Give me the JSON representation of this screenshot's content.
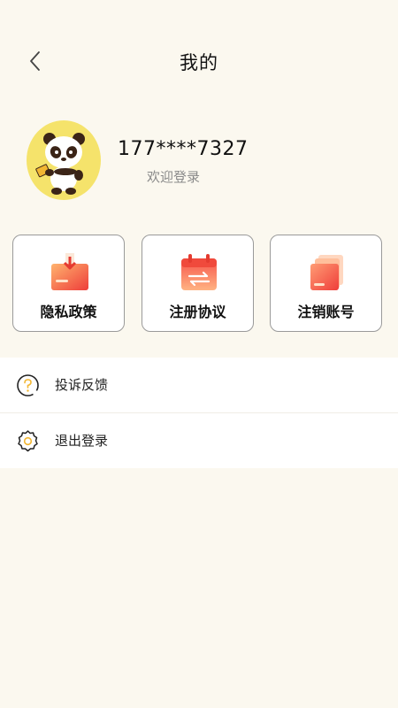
{
  "header": {
    "title": "我的"
  },
  "profile": {
    "phone": "177****7327",
    "subtitle": "欢迎登录"
  },
  "cards": [
    {
      "label": "隐私政策",
      "icon": "privacy-card-icon"
    },
    {
      "label": "注册协议",
      "icon": "calendar-agreement-icon"
    },
    {
      "label": "注销账号",
      "icon": "cancel-account-icon"
    }
  ],
  "menu": [
    {
      "label": "投诉反馈",
      "icon": "question-circle-icon"
    },
    {
      "label": "退出登录",
      "icon": "gear-icon"
    }
  ],
  "colors": {
    "background": "#fbf8ef",
    "accent_red": "#f04a3c",
    "accent_orange": "#ffb67a",
    "avatar_bg": "#f5e36b"
  }
}
